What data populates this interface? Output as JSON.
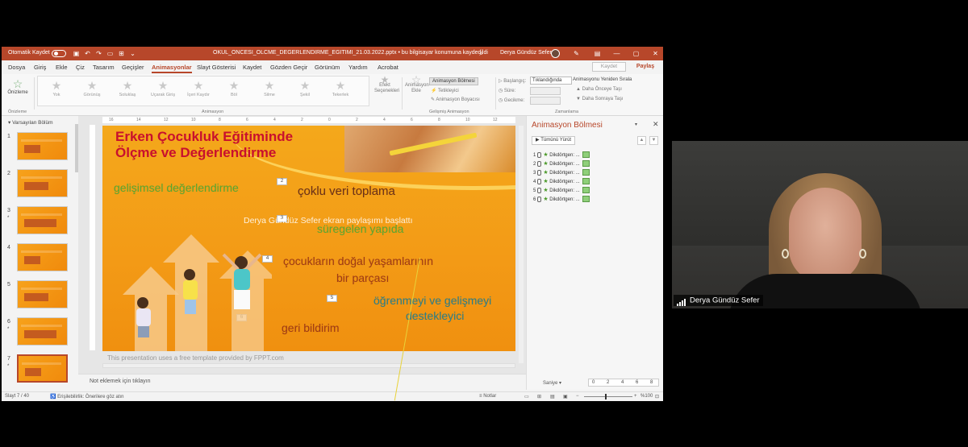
{
  "titlebar": {
    "autosave": "Otomatik Kaydet",
    "file_name": "OKUL_ONCESI_OLCME_DEGERLENDIRME_EGITIMI_21.03.2022.pptx • bu bilgisayar konumuna kaydedildi",
    "user": "Derya Gündüz Sefer"
  },
  "menu": {
    "items": [
      "Dosya",
      "Giriş",
      "Ekle",
      "Çiz",
      "Tasarım",
      "Geçişler",
      "Animasyonlar",
      "Slayt Gösterisi",
      "Kaydet",
      "Gözden Geçir",
      "Görünüm",
      "Yardım",
      "Acrobat"
    ],
    "active": "Animasyonlar",
    "kaydet_button": "Kaydet",
    "share_button": "Paylaş"
  },
  "ribbon": {
    "preview": "Önizleme",
    "preview_group": "Önizleme",
    "effects": [
      "Yok",
      "Görünüş",
      "Soluklaş",
      "Uçarak Giriş",
      "İçeri Kaydır",
      "Böl",
      "Silme",
      "Şekil",
      "Tekerlek"
    ],
    "effect_options": "Efekt Seçenekleri",
    "animation_group": "Animasyon",
    "add_animation": "Animasyon Ekle",
    "animation_pane": "Animasyon Bölmesi",
    "trigger": "Tetikleyici",
    "animation_painter": "Animasyon Boyacısı",
    "advanced_group": "Gelişmiş Animasyon",
    "start_label": "Başlangıç:",
    "start_value": "Tıklandığında",
    "duration_label": "Süre:",
    "delay_label": "Gecikme:",
    "timing_group": "Zamanlama",
    "reorder_title": "Animasyonu Yeniden Sırala",
    "move_earlier": "Daha Önceye Taşı",
    "move_later": "Daha Sonraya Taşı"
  },
  "thumbnails": {
    "section": "Varsayılan Bölüm",
    "slides": [
      {
        "num": "1",
        "star": ""
      },
      {
        "num": "2",
        "star": ""
      },
      {
        "num": "3",
        "star": "*"
      },
      {
        "num": "4",
        "star": ""
      },
      {
        "num": "5",
        "star": ""
      },
      {
        "num": "6",
        "star": "*"
      },
      {
        "num": "7",
        "star": "*"
      }
    ],
    "selected": "7"
  },
  "slide": {
    "title_line1": "Erken Çocukluk Eğitiminde",
    "title_line2": "Ölçme ve Değerlendirme",
    "items": [
      "gelişimsel değerlendirme",
      "çoklu veri toplama",
      "süregelen yapıda",
      "çocukların doğal yaşamlarının",
      "bir parçası",
      "öğrenmeyi ve gelişmeyi",
      "destekleyici",
      "geri bildirim"
    ],
    "tags": [
      "2",
      "3",
      "4",
      "5",
      "6"
    ],
    "overlay_message": "Derya Gündüz Sefer ekran paylaşımı başlattı",
    "footer": "This presentation uses a free template provided by FPPT.com",
    "ruler": [
      "16",
      "14",
      "12",
      "10",
      "8",
      "6",
      "4",
      "2",
      "0",
      "2",
      "4",
      "6",
      "8",
      "10",
      "12"
    ]
  },
  "notes_placeholder": "Not eklemek için tıklayın",
  "anim_pane": {
    "title": "Animasyon Bölmesi",
    "play_all": "Tümünü Yürüt",
    "items": [
      {
        "num": "1",
        "label": "Dikdörtgen: ..."
      },
      {
        "num": "2",
        "label": "Dikdörtgen: ..."
      },
      {
        "num": "3",
        "label": "Dikdörtgen: ..."
      },
      {
        "num": "4",
        "label": "Dikdörtgen: ..."
      },
      {
        "num": "5",
        "label": "Dikdörtgen: ..."
      },
      {
        "num": "6",
        "label": "Dikdörtgen: ..."
      }
    ],
    "seconds": "Saniye",
    "timeline": [
      "0",
      "2",
      "4",
      "6",
      "8"
    ]
  },
  "statusbar": {
    "slide_count": "Slayt 7 / 40",
    "accessibility": "Erişilebilirlik: Önerilere göz atın",
    "notes": "Notlar",
    "zoom": "%100"
  },
  "video": {
    "participant": "Derya Gündüz Sefer"
  },
  "colors": {
    "accent": "#b7472a",
    "slide_bg": "#f39a16",
    "title_red": "#c8102e",
    "green_text": "#5aa832"
  }
}
